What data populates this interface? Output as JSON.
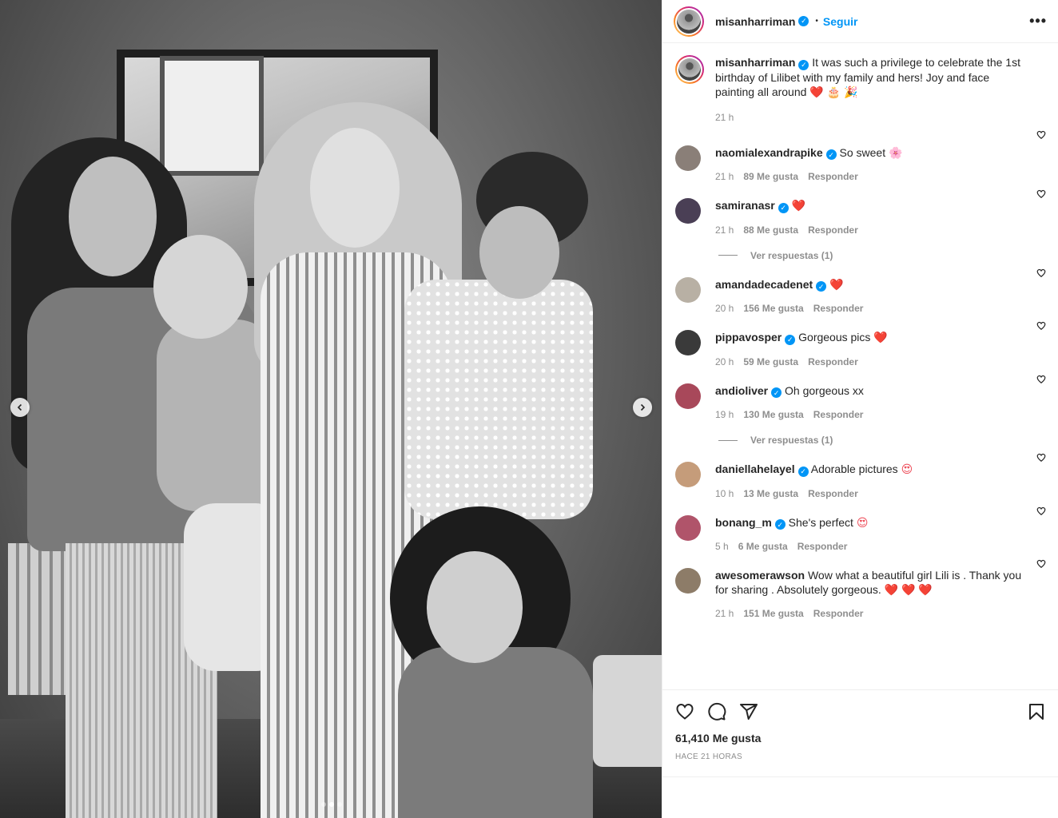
{
  "header": {
    "username": "misanharriman",
    "follow_label": "Seguir",
    "more_label": "•••"
  },
  "caption": {
    "username": "misanharriman",
    "text": "It was such a privilege to celebrate the 1st birthday of Lilibet with my family and hers! Joy and face painting all around",
    "emojis": "❤️ 🎂 🎉",
    "time": "21 h"
  },
  "comments": [
    {
      "username": "naomialexandrapike",
      "text": "So sweet",
      "emoji": "🌸",
      "time": "21 h",
      "likes": "89 Me gusta",
      "reply": "Responder",
      "avatar_color": "#8a7f78"
    },
    {
      "username": "samiranasr",
      "text": "",
      "emoji": "❤️",
      "time": "21 h",
      "likes": "88 Me gusta",
      "reply": "Responder",
      "avatar_color": "#4a3f55",
      "view_replies": "Ver respuestas (1)"
    },
    {
      "username": "amandadecadenet",
      "text": "",
      "emoji": "❤️",
      "time": "20 h",
      "likes": "156 Me gusta",
      "reply": "Responder",
      "avatar_color": "#b8b0a4"
    },
    {
      "username": "pippavosper",
      "text": "Gorgeous pics",
      "emoji": "❤️",
      "time": "20 h",
      "likes": "59 Me gusta",
      "reply": "Responder",
      "avatar_color": "#3a3a3a"
    },
    {
      "username": "andioliver",
      "text": "Oh gorgeous xx",
      "emoji": "",
      "time": "19 h",
      "likes": "130 Me gusta",
      "reply": "Responder",
      "avatar_color": "#a8485a",
      "view_replies": "Ver respuestas (1)"
    },
    {
      "username": "daniellahelayel",
      "text": "Adorable pictures",
      "emoji": "😍",
      "time": "10 h",
      "likes": "13 Me gusta",
      "reply": "Responder",
      "avatar_color": "#c59c7a"
    },
    {
      "username": "bonang_m",
      "text": "She's perfect",
      "emoji": "😍",
      "time": "5 h",
      "likes": "6 Me gusta",
      "reply": "Responder",
      "avatar_color": "#b0546a"
    },
    {
      "username": "awesomerawson",
      "text": "Wow what a beautiful girl Lili is . Thank you for sharing . Absolutely gorgeous.",
      "emoji": "❤️ ❤️ ❤️",
      "time": "21 h",
      "likes": "151 Me gusta",
      "reply": "Responder",
      "avatar_color": "#8d7c68"
    }
  ],
  "footer": {
    "likes": "61,410 Me gusta",
    "ago": "HACE 21 HORAS"
  },
  "carousel": {
    "total": 3,
    "active": 2
  },
  "icons": {
    "like": "heart-icon",
    "comment": "comment-icon",
    "share": "send-icon",
    "save": "bookmark-icon",
    "prev": "chevron-left-icon",
    "next": "chevron-right-icon",
    "more": "more-dots-icon"
  },
  "colors": {
    "accent": "#0095f6",
    "heart": "#ed4956",
    "muted": "#8e8e8e"
  }
}
